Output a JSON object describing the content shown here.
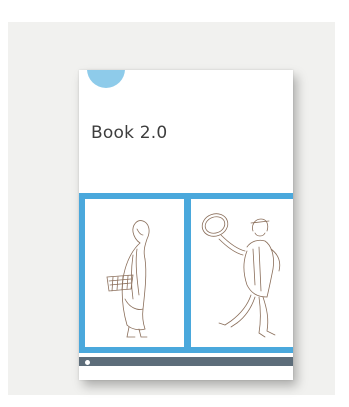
{
  "cover": {
    "title": "Book 2.0",
    "badge_text": "",
    "publisher_label": "",
    "issn_label": ""
  },
  "colors": {
    "background": "#f1f1ef",
    "accent": "#4aa8dc",
    "badge": "#8ecbea",
    "footer": "#5d6d7a"
  },
  "illustrations": [
    "woman-with-basket-sketch",
    "man-with-tambourine-sketch"
  ]
}
